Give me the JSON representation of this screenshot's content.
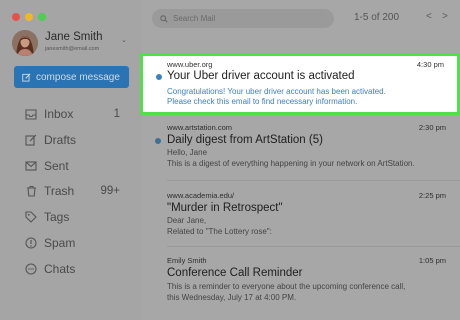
{
  "window": {
    "traffic_lights": [
      "#e8514a",
      "#f2b52b",
      "#4ccf4e"
    ]
  },
  "account": {
    "name": "Jane Smith",
    "email": "janesmith@email.com"
  },
  "compose_label": "compose message",
  "nav": [
    {
      "label": "Inbox",
      "count": "1",
      "icon": "inbox-icon"
    },
    {
      "label": "Drafts",
      "count": "",
      "icon": "drafts-icon"
    },
    {
      "label": "Sent",
      "count": "",
      "icon": "sent-icon"
    },
    {
      "label": "Trash",
      "count": "99+",
      "icon": "trash-icon"
    },
    {
      "label": "Tags",
      "count": "",
      "icon": "tag-icon"
    },
    {
      "label": "Spam",
      "count": "",
      "icon": "spam-icon"
    },
    {
      "label": "Chats",
      "count": "",
      "icon": "chat-icon"
    }
  ],
  "search": {
    "placeholder": "Search Mail"
  },
  "pager": {
    "text": "1-5 of 200",
    "prev": "<",
    "next": ">"
  },
  "emails": [
    {
      "from": "www.uber.org",
      "time": "4:30 pm",
      "subject": "Your Uber driver account is activated",
      "preview1": "Congratulations! Your uber driver account has been activated.",
      "preview2": "Please check this email to find necessary information.",
      "unread": true
    },
    {
      "from": "www.artstation.com",
      "time": "2:30 pm",
      "subject": "Daily digest from ArtStation (5)",
      "preview1": "Hello, Jane",
      "preview2": "This is a digest of everything happening in your network on ArtStation.",
      "unread": true
    },
    {
      "from": "www.academia.edu/",
      "time": "2:25 pm",
      "subject": "\"Murder in Retrospect\"",
      "preview1": "Dear Jane,",
      "preview2": "Related to \"The Lottery rose\":",
      "unread": false
    },
    {
      "from": "Emily Smith",
      "time": "1:05 pm",
      "subject": "Conference Call Reminder",
      "preview1": "This is a reminder to everyone about the upcoming conference call,",
      "preview2": "this Wednesday, July 17 at 4:00 PM.",
      "unread": false
    }
  ],
  "colors": {
    "accent": "#2b74b3",
    "highlight_border": "#4fe04a",
    "unread_dot": "#3b82c4"
  }
}
